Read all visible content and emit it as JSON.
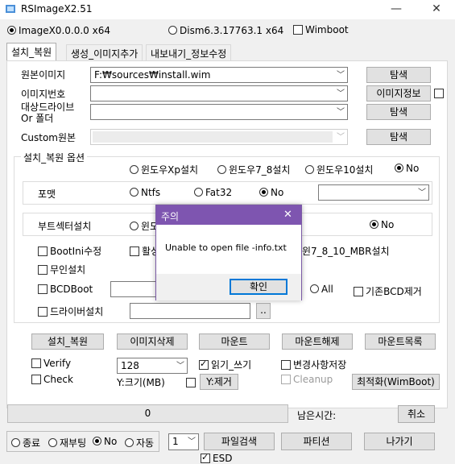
{
  "window": {
    "title": "RSImageX2.51",
    "minimize": "—",
    "close": "✕"
  },
  "top": {
    "imagex_label": "ImageX0.0.0.0 x64",
    "dism_label": "Dism6.3.17763.1 x64",
    "wimboot_label": "Wimboot"
  },
  "tabs": [
    {
      "label": "설치_복원"
    },
    {
      "label": "생성_이미지추가"
    },
    {
      "label": "내보내기_정보수정"
    }
  ],
  "form": {
    "source_label": "원본이미지",
    "source_value": "F:₩sources₩install.wim",
    "browse_label": "탐색",
    "image_index_label": "이미지번호",
    "image_info_label": "이미지정보",
    "target_label_line1": "대상드라이브",
    "target_label_line2": "Or 폴더",
    "custom_label": "Custom원본"
  },
  "options": {
    "legend": "설치_복원 옵션",
    "os_xp": "윈도우Xp설치",
    "os_78": "윈도우7_8설치",
    "os_10": "윈도우10설치",
    "os_no": "No",
    "format_label": "포맷",
    "fmt_ntfs": "Ntfs",
    "fmt_fat32": "Fat32",
    "fmt_no": "No",
    "bootsector_label": "부트섹터설치",
    "bs_win_partial": "윈도",
    "bs_no": "No",
    "bootini": "BootIni수정",
    "activate_partial": "활성",
    "mbr": "윈7_8_10_MBR설치",
    "unattend": "무인설치",
    "bcdboot": "BCDBoot",
    "all": "All",
    "existing_bcd": "기존BCD제거",
    "driver": "드라이버설치",
    "ellipsis": ".."
  },
  "actions": {
    "install_restore": "설치_복원",
    "delete_image": "이미지삭제",
    "mount": "마운트",
    "unmount": "마운트해제",
    "mount_list": "마운트목록"
  },
  "settings": {
    "verify": "Verify",
    "check": "Check",
    "size_value": "128",
    "readwrite": "읽기_쓰기",
    "save_changes": "변경사항저장",
    "cleanup": "Cleanup",
    "optimize": "최적화(WimBoot)",
    "y_size": "Y:크기(MB)",
    "y_remove": "Y:제거"
  },
  "progress": {
    "percent_text": "0",
    "remaining_label": "남은시간:",
    "cancel": "취소",
    "value": 0
  },
  "bottom": {
    "shutdown": "종료",
    "reboot": "재부팅",
    "no": "No",
    "auto": "자동",
    "count_value": "1",
    "file_search": "파일검색",
    "partition": "파티션",
    "exit": "나가기",
    "esd": "ESD"
  },
  "dialog": {
    "title": "주의",
    "message": "Unable to open file -info.txt",
    "ok": "확인",
    "close": "✕"
  },
  "colors": {
    "dialog_title_bg": "#7e55b0",
    "accent_border": "#0078d7"
  }
}
